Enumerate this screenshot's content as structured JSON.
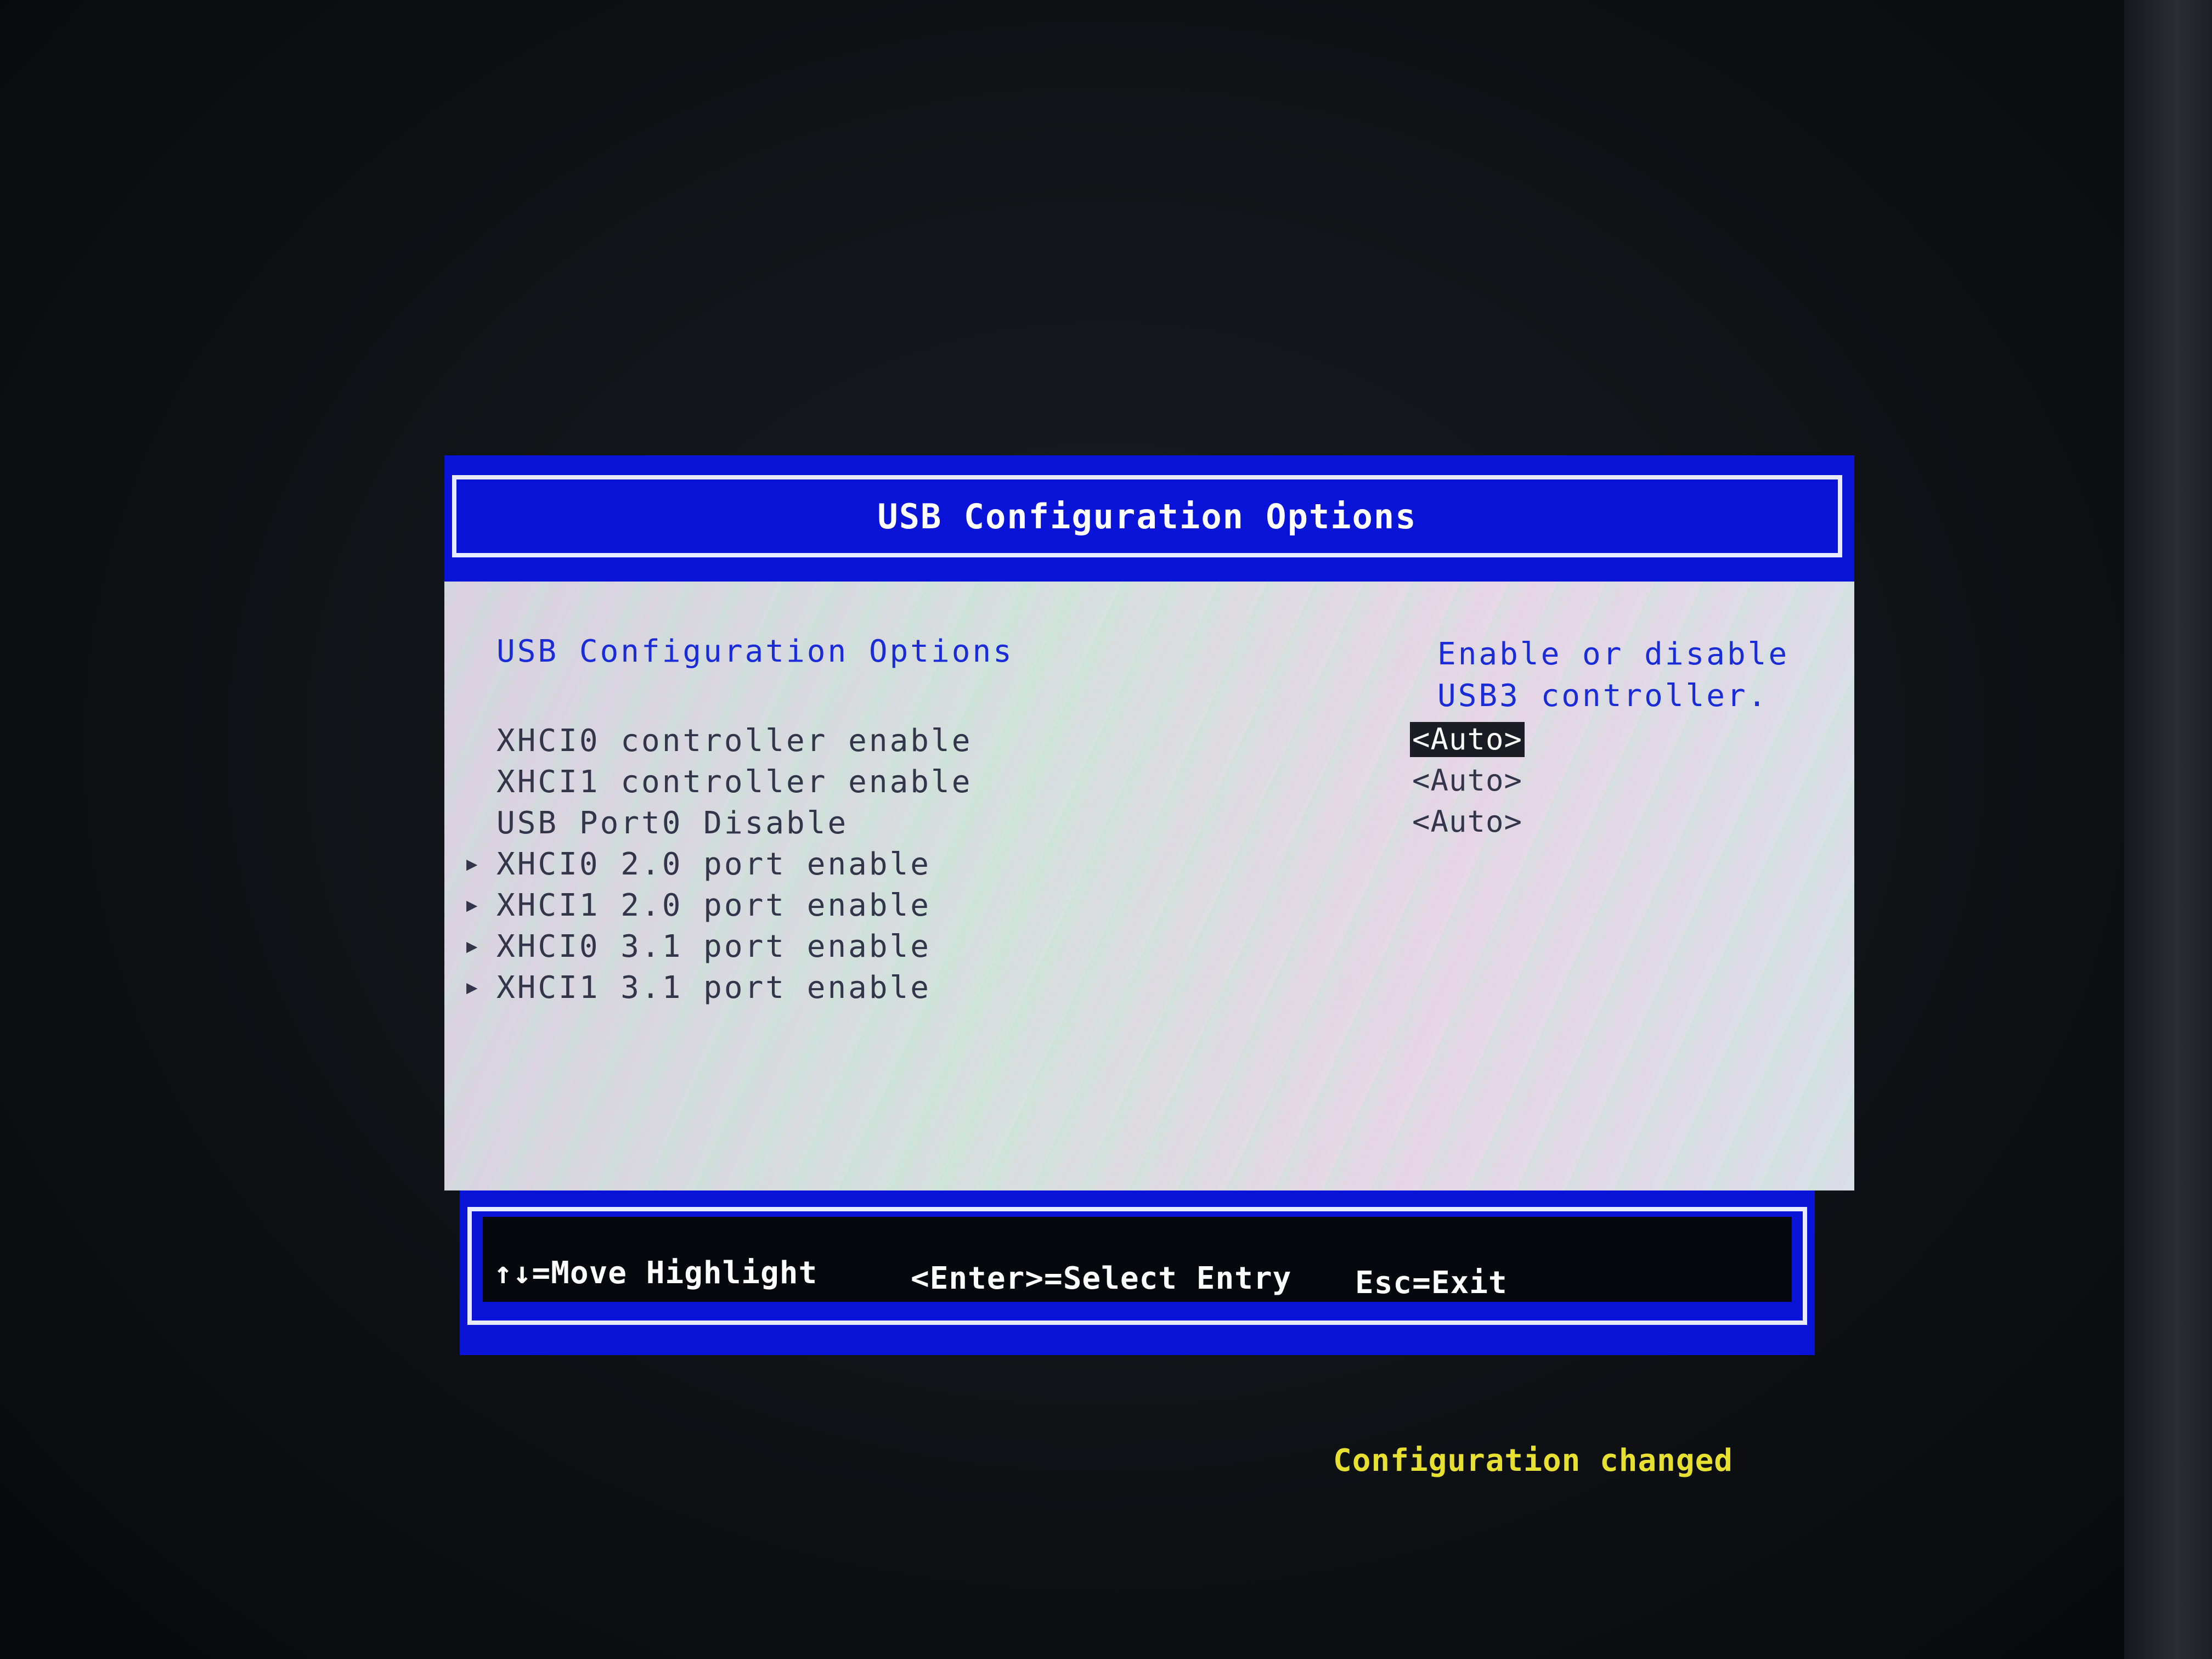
{
  "window": {
    "title": "USB Configuration Options"
  },
  "main": {
    "section_heading": "USB Configuration Options",
    "help": {
      "lines": [
        "Enable or disable",
        "USB3 controller."
      ]
    },
    "items": [
      {
        "label": "XHCI0 controller enable",
        "value": "<Auto>",
        "selected": true,
        "submenu": false
      },
      {
        "label": "XHCI1 controller enable",
        "value": "<Auto>",
        "selected": false,
        "submenu": false
      },
      {
        "label": "USB Port0 Disable",
        "value": "<Auto>",
        "selected": false,
        "submenu": false
      },
      {
        "label": "XHCI0 2.0 port enable",
        "value": "",
        "selected": false,
        "submenu": true
      },
      {
        "label": "XHCI1 2.0 port enable",
        "value": "",
        "selected": false,
        "submenu": true
      },
      {
        "label": "XHCI0 3.1 port enable",
        "value": "",
        "selected": false,
        "submenu": true
      },
      {
        "label": "XHCI1 3.1 port enable",
        "value": "",
        "selected": false,
        "submenu": true
      }
    ],
    "submenu_marker": "▶"
  },
  "footer": {
    "move_hint": "↑↓=Move Highlight",
    "select_hint": "<Enter>=Select Entry",
    "exit_hint": "Esc=Exit"
  },
  "status": {
    "message": "Configuration changed"
  },
  "colors": {
    "bar_blue": "#0a14d8",
    "text_blue": "#1a2cd8",
    "status_yellow": "#e8e030"
  }
}
